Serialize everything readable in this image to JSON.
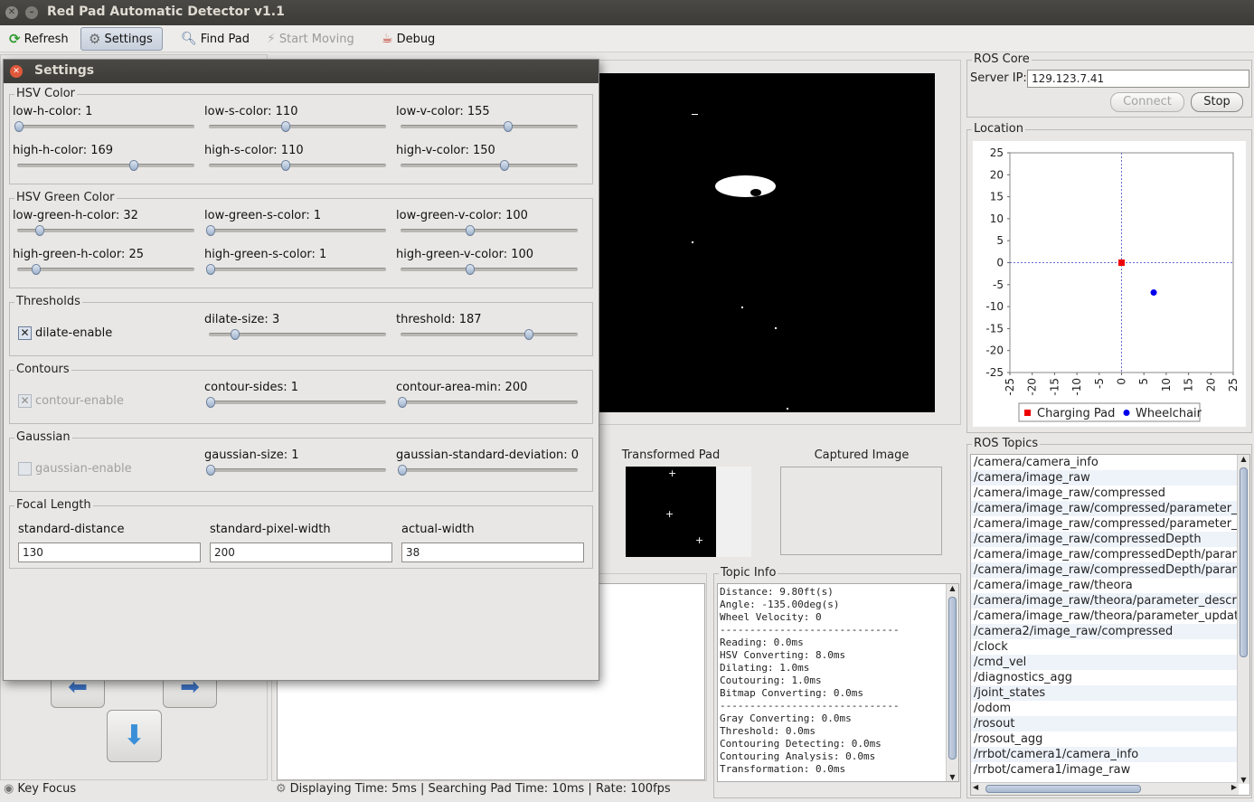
{
  "window": {
    "title": "Red Pad Automatic Detector v1.1"
  },
  "toolbar": {
    "refresh": "Refresh",
    "settings": "Settings",
    "find_pad": "Find Pad",
    "start_moving": "Start Moving",
    "debug": "Debug"
  },
  "settings": {
    "title": "Settings",
    "hsv": {
      "title": "HSV Color",
      "sliders": [
        {
          "label": "low-h-color: 1",
          "fraction": 0.0
        },
        {
          "label": "low-s-color: 110",
          "fraction": 0.43
        },
        {
          "label": "low-v-color: 155",
          "fraction": 0.61
        },
        {
          "label": "high-h-color: 169",
          "fraction": 0.66
        },
        {
          "label": "high-s-color: 110",
          "fraction": 0.43
        },
        {
          "label": "high-v-color: 150",
          "fraction": 0.59
        }
      ]
    },
    "green": {
      "title": "HSV Green Color",
      "sliders": [
        {
          "label": "low-green-h-color: 32",
          "fraction": 0.12
        },
        {
          "label": "low-green-s-color: 1",
          "fraction": 0.0
        },
        {
          "label": "low-green-v-color: 100",
          "fraction": 0.39
        },
        {
          "label": "high-green-h-color: 25",
          "fraction": 0.1
        },
        {
          "label": "high-green-s-color: 1",
          "fraction": 0.0
        },
        {
          "label": "high-green-v-color: 100",
          "fraction": 0.39
        }
      ]
    },
    "thresholds": {
      "title": "Thresholds",
      "checkbox": "dilate-enable",
      "sliders": [
        {
          "label": "dilate-size: 3",
          "fraction": 0.14
        },
        {
          "label": "threshold: 187",
          "fraction": 0.73
        }
      ]
    },
    "contours": {
      "title": "Contours",
      "checkbox": "contour-enable",
      "sliders": [
        {
          "label": "contour-sides: 1",
          "fraction": 0.0
        },
        {
          "label": "contour-area-min: 200",
          "fraction": 0.0
        }
      ]
    },
    "gaussian": {
      "title": "Gaussian",
      "checkbox": "gaussian-enable",
      "sliders": [
        {
          "label": "gaussian-size: 1",
          "fraction": 0.0
        },
        {
          "label": "gaussian-standard-deviation: 0",
          "fraction": 0.0
        }
      ]
    },
    "focal": {
      "title": "Focal Length",
      "fields": [
        {
          "label": "standard-distance",
          "value": "130"
        },
        {
          "label": "standard-pixel-width",
          "value": "200"
        },
        {
          "label": "actual-width",
          "value": "38"
        }
      ]
    }
  },
  "ros_core": {
    "title": "ROS Core",
    "server_ip_label": "Server IP:",
    "server_ip": "129.123.7.41",
    "connect": "Connect",
    "stop": "Stop"
  },
  "location": {
    "title": "Location",
    "legend_pad": "Charging Pad",
    "legend_wheelchair": "Wheelchair"
  },
  "chart_data": {
    "type": "scatter",
    "xlim": [
      -25,
      25
    ],
    "ylim": [
      -25,
      25
    ],
    "xticks": [
      "-25",
      "-20",
      "-15",
      "-10",
      "-5",
      "0",
      "5",
      "10",
      "15",
      "20",
      "25"
    ],
    "yticks": [
      "25",
      "20",
      "15",
      "10",
      "5",
      "0",
      "-5",
      "-10",
      "-15",
      "-20",
      "-25"
    ],
    "series": [
      {
        "name": "Charging Pad",
        "color": "#ee0000",
        "marker": "square",
        "points": [
          [
            0,
            0
          ]
        ]
      },
      {
        "name": "Wheelchair",
        "color": "#0000ee",
        "marker": "circle",
        "points": [
          [
            7.2,
            -6.8
          ]
        ]
      }
    ],
    "crosshair": true,
    "legend": "bottom"
  },
  "images": {
    "transformed_pad": "Transformed Pad",
    "captured_image": "Captured Image"
  },
  "topic_info": {
    "title": "Topic Info",
    "lines": [
      "Distance: 9.80ft(s)",
      "Angle: -135.00deg(s)",
      "Wheel Velocity: 0",
      "------------------------------",
      "Reading: 0.0ms",
      "HSV Converting: 8.0ms",
      "Dilating: 1.0ms",
      "Coutouring: 1.0ms",
      "Bitmap Converting: 0.0ms",
      "------------------------------",
      "Gray Converting: 0.0ms",
      "Threshold: 0.0ms",
      "Contouring Detecting: 0.0ms",
      "Contouring Analysis: 0.0ms",
      "Transformation: 0.0ms"
    ]
  },
  "ros_topics": {
    "title": "ROS Topics",
    "items": [
      "/camera/camera_info",
      "/camera/image_raw",
      "/camera/image_raw/compressed",
      "/camera/image_raw/compressed/parameter_de",
      "/camera/image_raw/compressed/parameter_up",
      "/camera/image_raw/compressedDepth",
      "/camera/image_raw/compressedDepth/parame",
      "/camera/image_raw/compressedDepth/parame",
      "/camera/image_raw/theora",
      "/camera/image_raw/theora/parameter_descript",
      "/camera/image_raw/theora/parameter_updates",
      "/camera2/image_raw/compressed",
      "/clock",
      "/cmd_vel",
      "/diagnostics_agg",
      "/joint_states",
      "/odom",
      "/rosout",
      "/rosout_agg",
      "/rrbot/camera1/camera_info",
      "/rrbot/camera1/image_raw"
    ]
  },
  "status": {
    "key_focus": "Key Focus",
    "bar": "Displaying Time: 5ms | Searching Pad Time: 10ms | Rate: 100fps"
  }
}
